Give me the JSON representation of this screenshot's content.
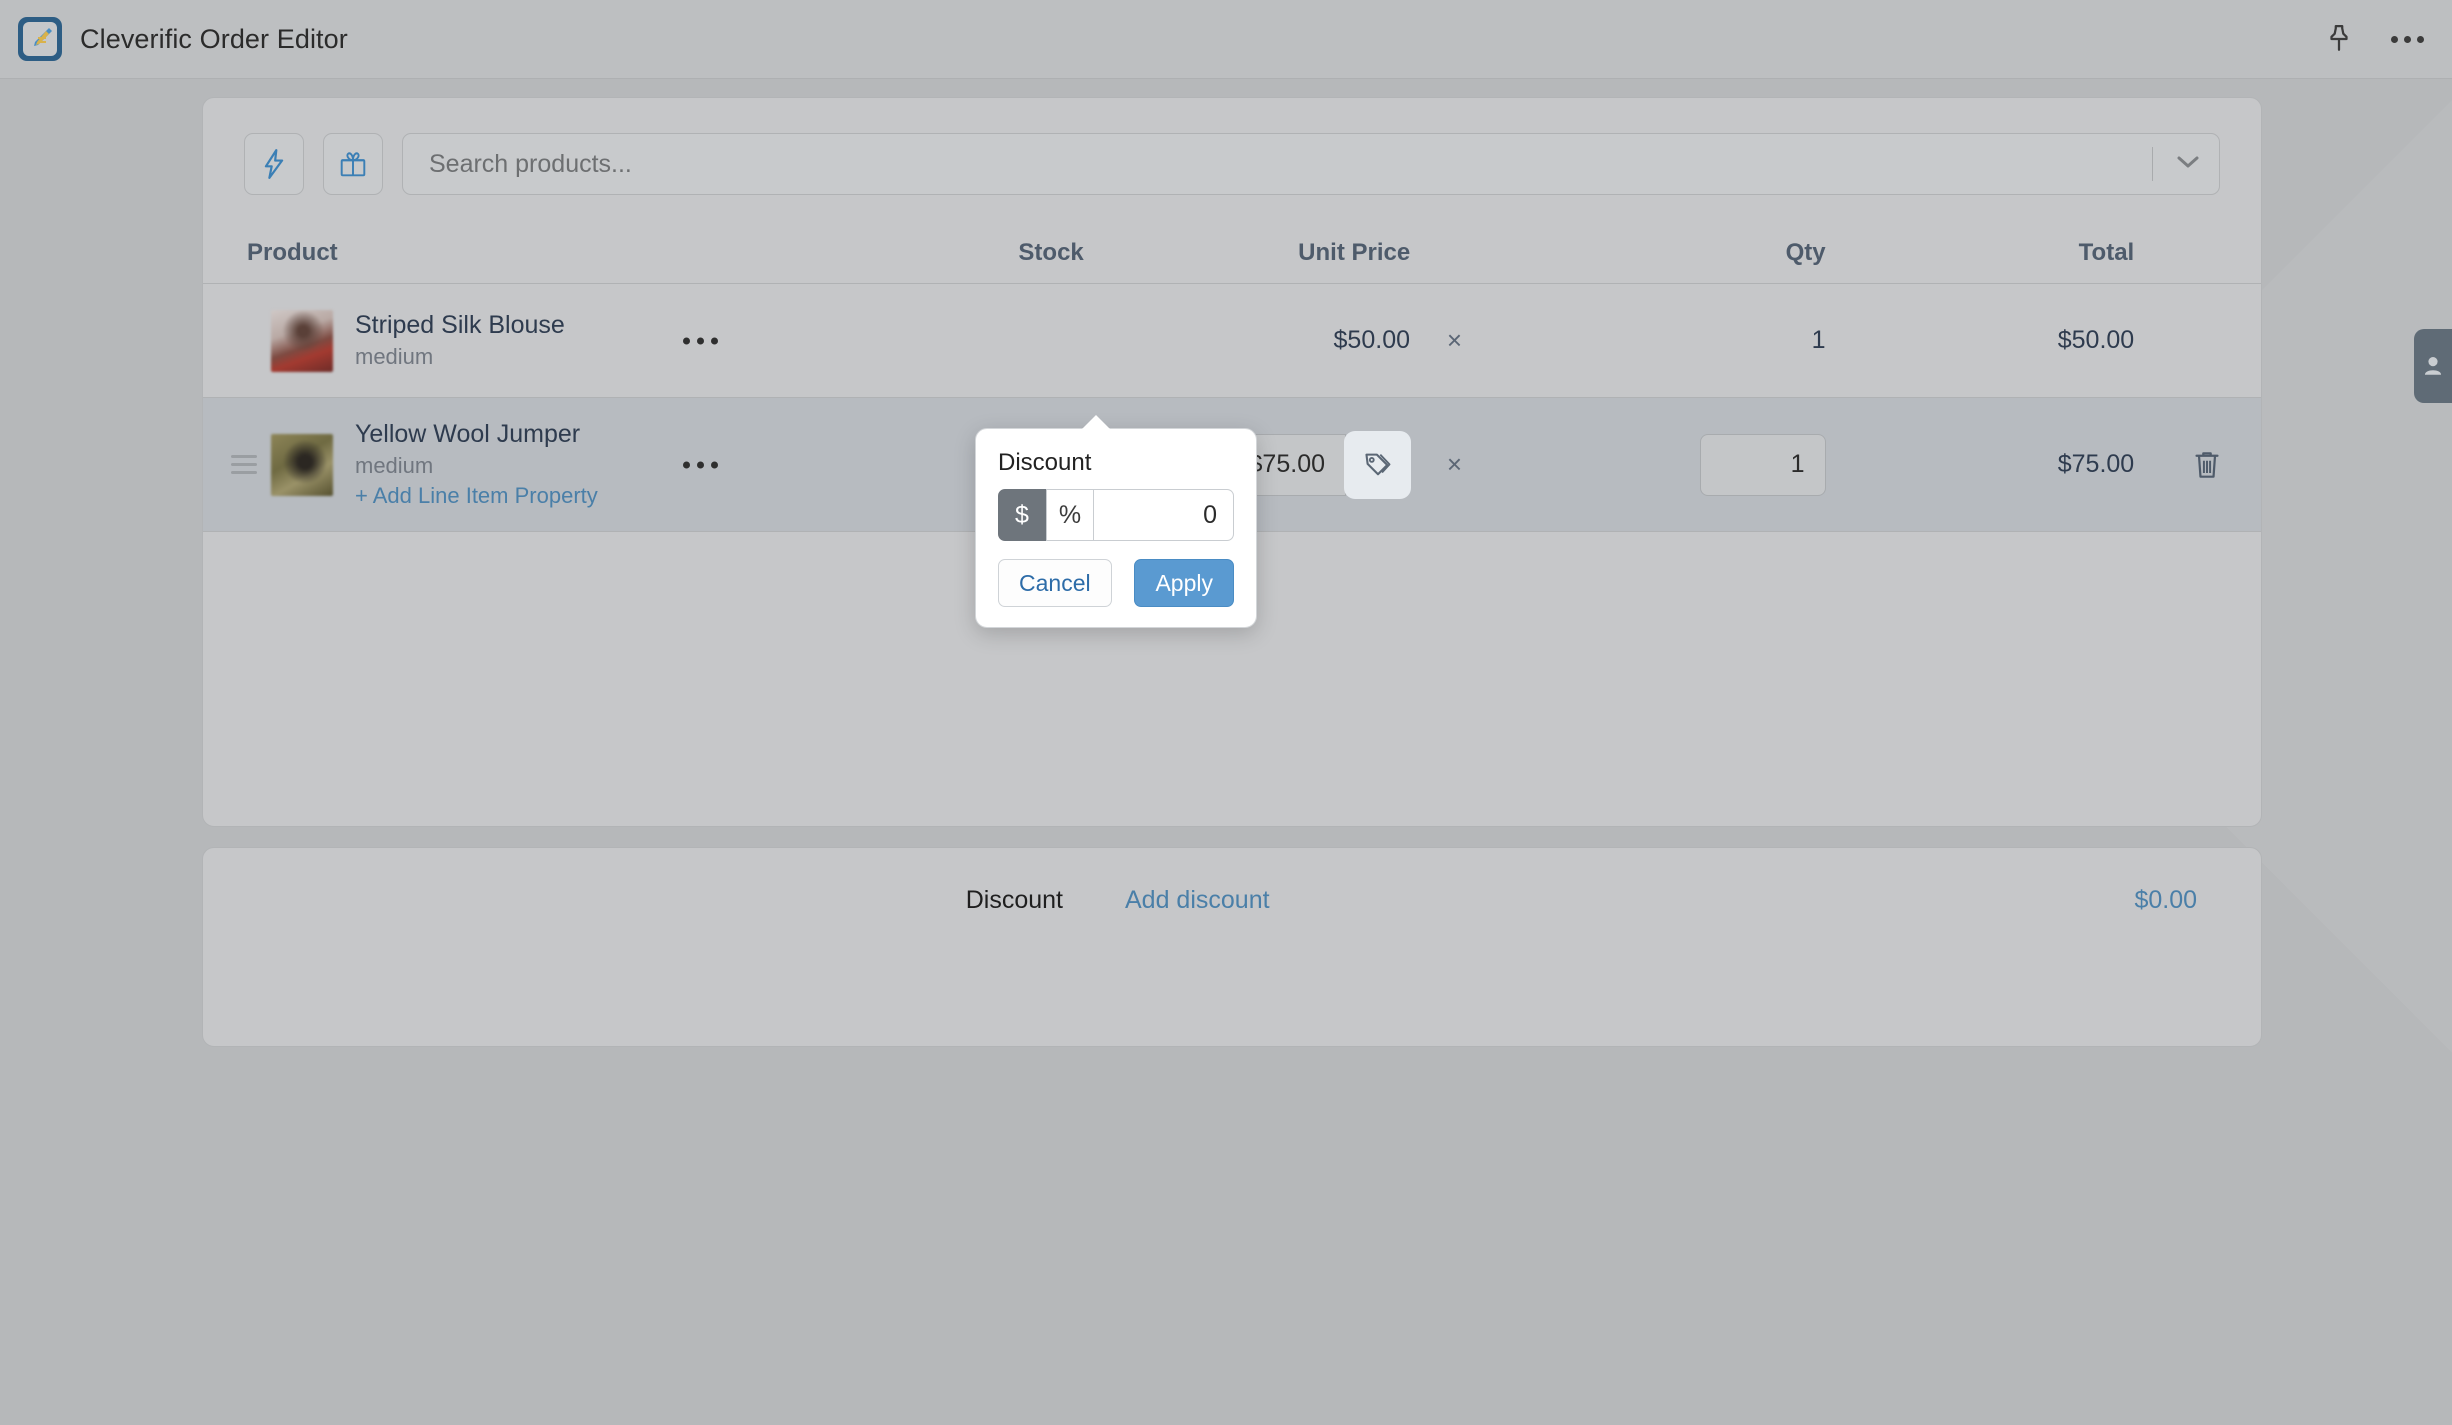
{
  "app": {
    "title": "Cleverific Order Editor",
    "logo_icon": "order-editor-logo-icon",
    "pin_icon": "pin-icon",
    "more_icon": "more-horizontal-icon"
  },
  "toolbar": {
    "quick_action_icon": "lightning-bolt-icon",
    "gift_icon": "gift-icon",
    "search_placeholder": "Search products...",
    "dropdown_icon": "chevron-down-icon"
  },
  "table": {
    "headers": {
      "product": "Product",
      "stock": "Stock",
      "unit_price": "Unit Price",
      "qty": "Qty",
      "total": "Total"
    },
    "rows": [
      {
        "name": "Striped Silk Blouse",
        "variant": "medium",
        "stock": "",
        "unit_price": "$50.00",
        "multiply": "×",
        "qty": "1",
        "total": "$50.00",
        "menu_icon": "more-horizontal-icon"
      },
      {
        "name": "Yellow Wool Jumper",
        "variant": "medium",
        "add_property_label": "+ Add Line Item Property",
        "stock": "",
        "unit_price": "$75.00",
        "multiply": "×",
        "qty": "1",
        "total": "$75.00",
        "menu_icon": "more-horizontal-icon",
        "discount_tag_icon": "price-tag-icon",
        "delete_icon": "trash-icon",
        "drag_icon": "drag-handle-icon"
      }
    ]
  },
  "discount_popover": {
    "title": "Discount",
    "currency_option": "$",
    "percent_option": "%",
    "value": "0",
    "cancel_label": "Cancel",
    "apply_label": "Apply",
    "selected_type": "$",
    "apply_color": "#5a9ad1",
    "active_segment_color": "#6e757c"
  },
  "summary": {
    "discount_label": "Discount",
    "add_discount_label": "Add discount",
    "discount_value": "$0.00"
  },
  "side_panel": {
    "customer_icon": "person-icon"
  },
  "colors": {
    "page_background": "#b6b8ba",
    "card_background": "#c6c7c9",
    "selected_row": "#b7bbc0",
    "link": "#4a7fa8",
    "heading": "#4e5b6b"
  }
}
